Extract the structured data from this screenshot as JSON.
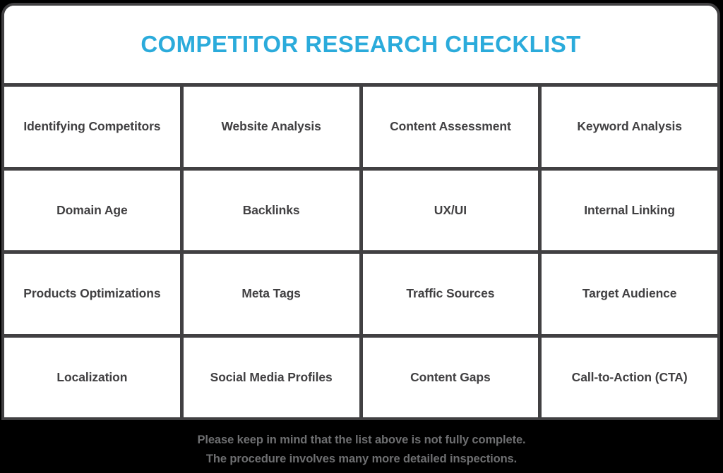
{
  "colors": {
    "accent": "#2BABDB",
    "frame": "#414042",
    "text": "#414042",
    "background": "#000000",
    "card": "#FFFFFF",
    "footer_text": "#6E6F71"
  },
  "header": {
    "title": "COMPETITOR RESEARCH CHECKLIST"
  },
  "grid": {
    "rows": [
      {
        "cells": [
          "Identifying Competitors",
          "Website Analysis",
          "Content Assessment",
          "Keyword Analysis"
        ]
      },
      {
        "cells": [
          "Domain Age",
          "Backlinks",
          "UX/UI",
          "Internal Linking"
        ]
      },
      {
        "cells": [
          "Products Optimizations",
          "Meta Tags",
          "Traffic Sources",
          "Target Audience"
        ]
      },
      {
        "cells": [
          "Localization",
          "Social Media Profiles",
          "Content Gaps",
          "Call-to-Action (CTA)"
        ]
      }
    ]
  },
  "footer": {
    "line1": "Please keep in mind that the list above is not fully complete.",
    "line2": "The procedure involves many more detailed inspections."
  }
}
